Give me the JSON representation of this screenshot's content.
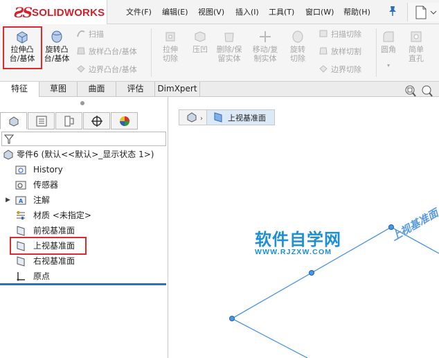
{
  "app": {
    "logo_text": "SOLIDWORKS",
    "brand_color": "#d5202a"
  },
  "menu": {
    "items": [
      "文件(F)",
      "编辑(E)",
      "视图(V)",
      "插入(I)",
      "工具(T)",
      "窗口(W)",
      "帮助(H)"
    ],
    "pin_icon": "pin-icon",
    "new_icon": "new-document-icon"
  },
  "ribbon": {
    "extrude_boss": "拉伸凸台/基体",
    "revolve_boss": "旋转凸台/基体",
    "sweep": "扫描",
    "loft_boss": "放样凸台/基体",
    "boundary_boss": "边界凸台/基体",
    "extrude_cut": "拉伸切除",
    "indent": "压凹",
    "delete_keep_body": "删除/保留实体",
    "move_copy_body": "移动/复制实体",
    "revolve_cut": "旋转切除",
    "swept_cut": "扫描切除",
    "lofted_cut": "放样切割",
    "boundary_cut": "边界切除",
    "fillet": "圆角",
    "simple_hole": "简单直孔"
  },
  "tabs": {
    "items": [
      "特征",
      "草图",
      "曲面",
      "评估",
      "DimXpert"
    ],
    "active": "特征"
  },
  "tree": {
    "part": "零件6  (默认<<默认>_显示状态 1>)",
    "history": "History",
    "sensors": "传感器",
    "annotations": "注解",
    "material": "材质 <未指定>",
    "front_plane": "前视基准面",
    "top_plane": "上视基准面",
    "right_plane": "右视基准面",
    "origin": "原点"
  },
  "graphics": {
    "breadcrumb_label": "上视基准面",
    "plane_label": "上视基准面",
    "watermark": "软件自学网",
    "watermark_url": "WWW.RJZXW.COM",
    "plane_color": "#4a95e6",
    "highlight_color": "#e02a2a"
  }
}
